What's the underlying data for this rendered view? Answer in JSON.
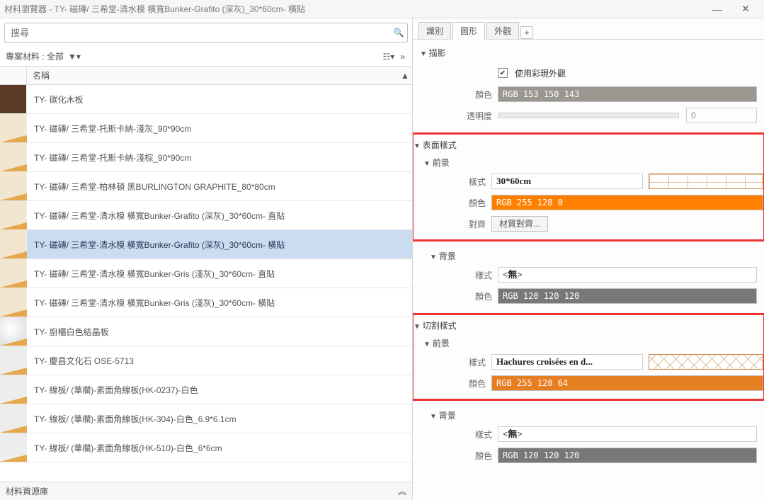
{
  "window": {
    "title": "材料瀏覽器 - TY- 磁磚/ 三希堂-清水模 橫寬Bunker-Grafito (深灰)_30*60cm- 橫貼"
  },
  "search": {
    "placeholder": "搜尋"
  },
  "left_toolbar": {
    "label": "專案材料 : 全部"
  },
  "header": {
    "name": "名稱"
  },
  "materials": [
    {
      "name": "TY- 碳化木板",
      "kind": "wood"
    },
    {
      "name": "TY- 磁磚/ 三希堂-托斯卡納-淺灰_90*90cm",
      "kind": "tile"
    },
    {
      "name": "TY- 磁磚/ 三希堂-托斯卡納-淺棕_90*90cm",
      "kind": "tile"
    },
    {
      "name": "TY- 磁磚/ 三希堂-柏林頓 黑BURLINGTON GRAPHITE_80*80cm",
      "kind": "tile"
    },
    {
      "name": "TY- 磁磚/ 三希堂-清水模 橫寬Bunker-Grafito (深灰)_30*60cm- 直貼",
      "kind": "tile"
    },
    {
      "name": "TY- 磁磚/ 三希堂-清水模 橫寬Bunker-Grafito (深灰)_30*60cm- 橫貼",
      "kind": "tile",
      "selected": true
    },
    {
      "name": "TY- 磁磚/ 三希堂-清水模 橫寬Bunker-Gris (淺灰)_30*60cm- 直貼",
      "kind": "tile"
    },
    {
      "name": "TY- 磁磚/ 三希堂-清水模 橫寬Bunker-Gris (淺灰)_30*60cm- 橫貼",
      "kind": "tile"
    },
    {
      "name": "TY- 廚櫃白色結晶板",
      "kind": "crystal"
    },
    {
      "name": "TY- 慶昌文化石 OSE-5713",
      "kind": "stone"
    },
    {
      "name": "TY- 線板/ (華欄)-素面角線板(HK-0237)-白色",
      "kind": "stone"
    },
    {
      "name": "TY- 線板/ (華欄)-素面角線板(HK-304)-白色_6.9*6.1cm",
      "kind": "stone"
    },
    {
      "name": "TY- 線板/ (華欄)-素面角線板(HK-510)-白色_6*6cm",
      "kind": "stone"
    }
  ],
  "lib_bar": {
    "label": "材料資源庫"
  },
  "tabs": {
    "identity": "識別",
    "graphics": "圖形",
    "appearance": "外觀"
  },
  "props": {
    "shading_title": "描影",
    "use_render": "使用彩現外觀",
    "color_lbl": "顏色",
    "transparency_lbl": "透明度",
    "transparency_val": "0",
    "shading_color": "RGB 153 150 143",
    "surface_title": "表面樣式",
    "cut_title": "切割樣式",
    "foreground": "前景",
    "background": "背景",
    "pattern_lbl": "樣式",
    "align_lbl": "對齊",
    "align_btn": "材質對齊...",
    "surf_fg_pattern": "30*60cm",
    "surf_fg_color": "RGB 255 128 0",
    "surf_bg_pattern": "<無>",
    "surf_bg_color": "RGB 120 120 120",
    "cut_fg_pattern": "Hachures croisées en d...",
    "cut_fg_color": "RGB 255 128 64",
    "cut_bg_pattern": "<無>",
    "cut_bg_color": "RGB 120 120 120"
  }
}
